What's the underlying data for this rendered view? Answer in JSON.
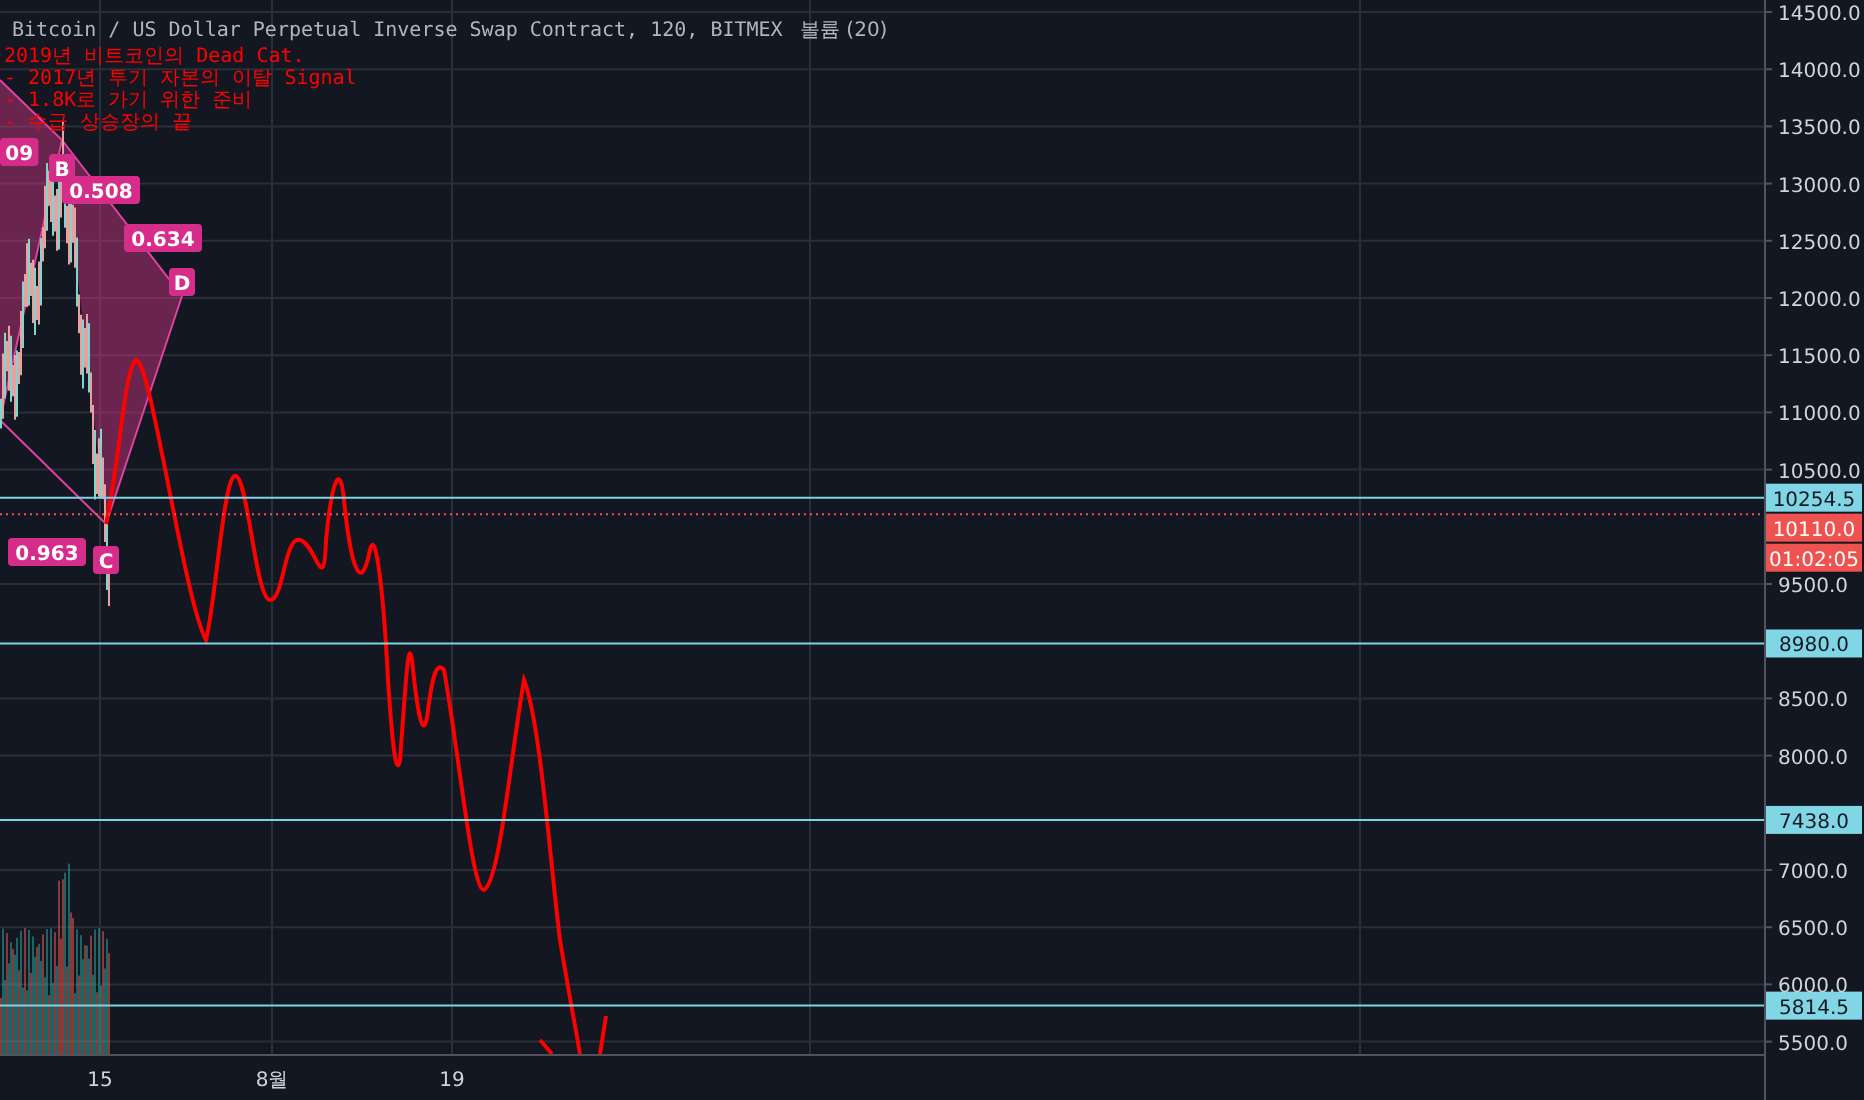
{
  "chart": {
    "title": "Bitcoin / US Dollar Perpetual Inverse Swap Contract, 120, BITMEX",
    "volume_legend": "볼륨 (20)",
    "annotation_lines": [
      "2019년 비트코인의 Dead Cat.",
      "- 2017년 투기 자본의 이탈 Signal",
      "- 1.8K로 가기 위한 준비",
      "- 수급 상승장의 끝"
    ],
    "pattern_labels": [
      {
        "text": "09",
        "kind": "ratio"
      },
      {
        "text": "B",
        "kind": "point"
      },
      {
        "text": "0.508",
        "kind": "ratio"
      },
      {
        "text": "0.634",
        "kind": "ratio"
      },
      {
        "text": "D",
        "kind": "point"
      },
      {
        "text": "0.963",
        "kind": "ratio"
      },
      {
        "text": "C",
        "kind": "point"
      }
    ],
    "price_axis": [
      "14500.0",
      "14000.0",
      "13500.0",
      "13000.0",
      "12500.0",
      "12000.0",
      "11500.0",
      "11000.0",
      "10500.0",
      "9500.0",
      "8500.0",
      "8000.0",
      "7000.0",
      "6500.0",
      "6000.0",
      "5500.0"
    ],
    "price_badges": [
      {
        "text": "10254.5",
        "kind": "level"
      },
      {
        "text": "10110.0",
        "kind": "last"
      },
      {
        "text": "01:02:05",
        "kind": "countdown"
      },
      {
        "text": "8980.0",
        "kind": "level"
      },
      {
        "text": "7438.0",
        "kind": "level"
      },
      {
        "text": "5814.5",
        "kind": "level"
      }
    ],
    "time_axis": [
      "15",
      "8월",
      "19"
    ]
  }
}
